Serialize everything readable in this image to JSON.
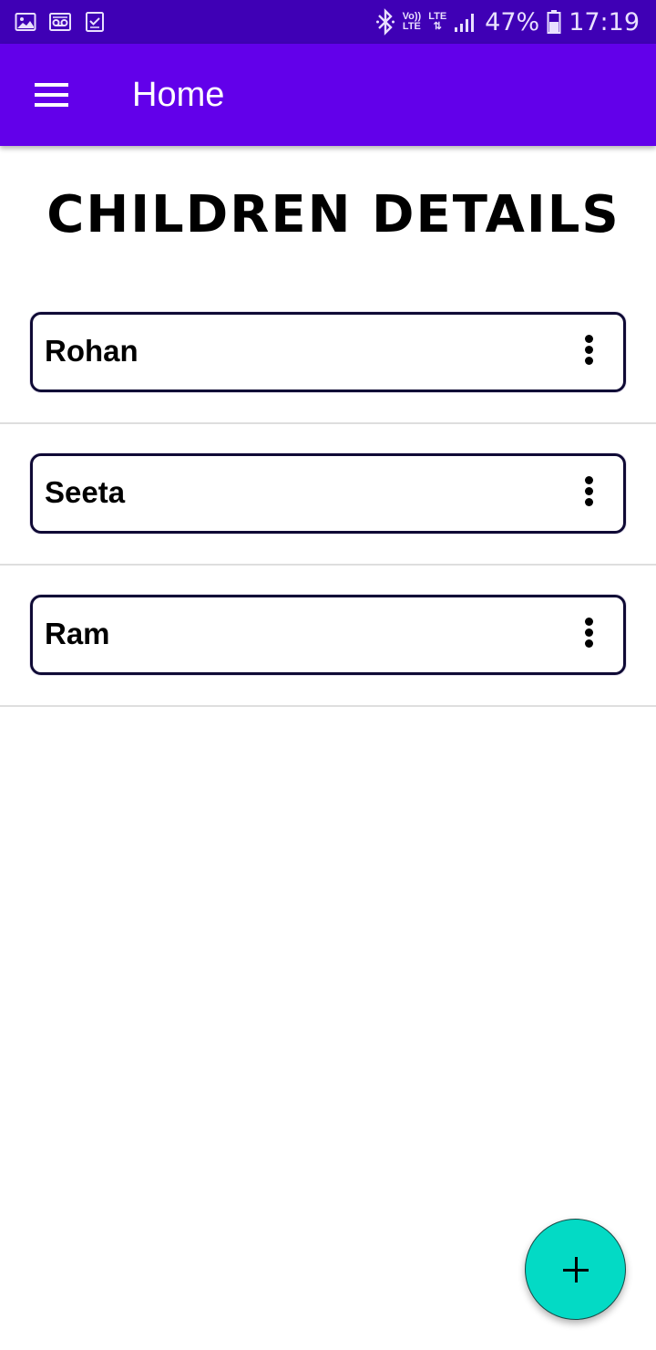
{
  "status_bar": {
    "left_icons": [
      "image-icon",
      "voicemail-icon",
      "task-check-icon"
    ],
    "volte_top": "Vo))",
    "volte_bottom": "LTE",
    "lte_label": "LTE",
    "battery_percent": "47%",
    "time": "17:19",
    "background_color": "#3f00b5"
  },
  "app_bar": {
    "title": "Home",
    "menu_icon": "hamburger-menu-icon",
    "background_color": "#6200ea"
  },
  "heading": "CHILDREN DETAILS",
  "children": [
    {
      "name": "Rohan",
      "menu_icon": "more-vert-icon"
    },
    {
      "name": "Seeta",
      "menu_icon": "more-vert-icon"
    },
    {
      "name": "Ram",
      "menu_icon": "more-vert-icon"
    }
  ],
  "fab": {
    "icon": "plus-icon",
    "color": "#03dac5"
  }
}
